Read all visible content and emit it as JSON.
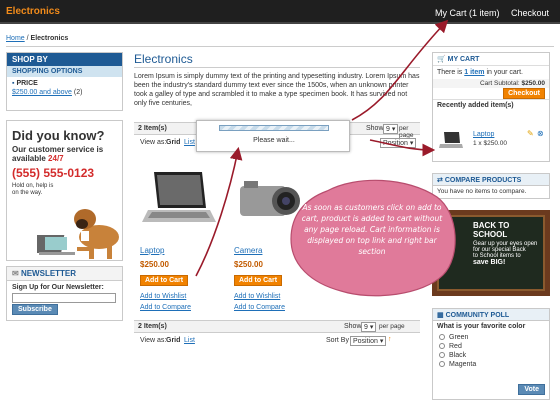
{
  "header": {
    "store_title": "Electronics",
    "mycart": "My Cart (1 item)",
    "checkout": "Checkout"
  },
  "breadcrumb": {
    "home": "Home",
    "sep": " / ",
    "current": "Electronics"
  },
  "left": {
    "shop_by": "SHOP BY",
    "shopping_options": "SHOPPING OPTIONS",
    "price_label": "PRICE",
    "price_link": "$250.00 and above",
    "price_count": "(2)",
    "dyk_title": "Did you know?",
    "dyk_line1": "Our customer service is",
    "dyk_line2": "available",
    "dyk_hours": "24/7",
    "dyk_phone": "(555) 555-0123",
    "dyk_note1": "Hold on, help is",
    "dyk_note2": "on the way.",
    "newsletter_title": "NEWSLETTER",
    "newsletter_label": "Sign Up for Our Newsletter:",
    "subscribe": "Subscribe"
  },
  "main": {
    "title": "Electronics",
    "description": "Lorem Ipsum is simply dummy text of the printing and typesetting industry. Lorem Ipsum has been the industry's standard dummy text ever since the 1500s, when an unknown printer took a galley of type and scrambled it to make a type specimen book. It has survived not only five centuries,",
    "items": "2 Item(s)",
    "show": "Show",
    "show_value": "9",
    "per_page": "per page",
    "view_as": "View as:",
    "grid": "Grid",
    "list": "List",
    "sort_by": "Sort By",
    "sort_value": "Position",
    "products": [
      {
        "name": "Laptop",
        "price": "$250.00"
      },
      {
        "name": "Camera",
        "price": "$250.00"
      }
    ],
    "add_to_cart": "Add to Cart",
    "add_to_wishlist": "Add to Wishlist",
    "add_to_compare": "Add to Compare",
    "wait_text": "Please wait..."
  },
  "right": {
    "mycart_title": "MY CART",
    "cart_text1": "There is",
    "cart_item_link": "1 item",
    "cart_text2": "in your cart.",
    "subtotal_label": "Cart Subtotal:",
    "subtotal_value": "$250.00",
    "checkout_btn": "Checkout",
    "recent_title": "Recently added item(s)",
    "recent_name": "Laptop",
    "recent_qty": "1 x $250.00",
    "compare_title": "COMPARE PRODUCTS",
    "compare_text": "You have no items to compare.",
    "school_line1": "BACK TO SCHOOL",
    "school_line2": "Gear up your eyes open",
    "school_line3": "for our special Back",
    "school_line4": "to School items to",
    "school_line5": "save BIG!",
    "poll_title": "COMMUNITY POLL",
    "poll_question": "What is your favorite color",
    "poll_options": [
      "Green",
      "Red",
      "Black",
      "Magenta"
    ],
    "vote": "Vote"
  },
  "callout": "As soon as customers click on add to cart, product is added to cart without any page reload. Cart information is displayed on top link and right bar section",
  "colors": {
    "accent": "#f28b1a",
    "link": "#1e6fb8",
    "brand_blue": "#1e5a94",
    "callout": "#e07a9a"
  }
}
